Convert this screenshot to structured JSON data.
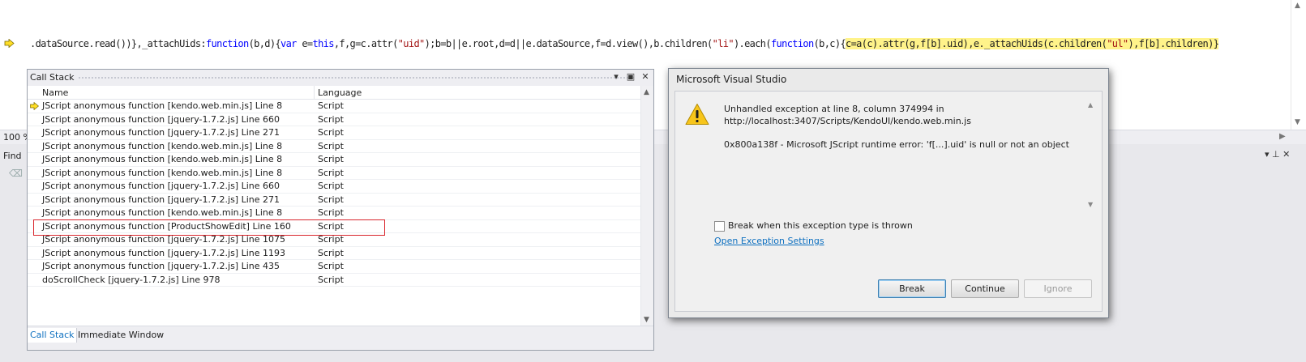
{
  "editor": {
    "code": {
      "prefix": ".dataSource.read())},_attachUids:",
      "kw_function1": "function",
      "args1": "(b,d){",
      "kw_var": "var",
      "mid1": " e=",
      "kw_this": "this",
      "mid2": ",f,g=c.attr(",
      "str_uid": "\"uid\"",
      "mid3": ");b=b||e.root,d=d||e.dataSource,f=d.view(),b.children(",
      "str_li": "\"li\"",
      "mid4": ").each(",
      "kw_function2": "function",
      "args2": "(b,c){",
      "hl_a": "c=a(c).attr(g,f[b].uid),e._attachUids(c.children(",
      "hl_str_ul": "\"ul\"",
      "hl_b": "),f[b].children)}"
    },
    "zoom": "100 %",
    "highlight_color": "#fff38a"
  },
  "find_panel": {
    "label": "Find"
  },
  "call_stack": {
    "title": "Call Stack",
    "columns": {
      "name": "Name",
      "language": "Language"
    },
    "rows": [
      {
        "name": "JScript anonymous function [kendo.web.min.js] Line 8",
        "language": "Script"
      },
      {
        "name": "JScript anonymous function [jquery-1.7.2.js] Line 660",
        "language": "Script"
      },
      {
        "name": "JScript anonymous function [jquery-1.7.2.js] Line 271",
        "language": "Script"
      },
      {
        "name": "JScript anonymous function [kendo.web.min.js] Line 8",
        "language": "Script"
      },
      {
        "name": "JScript anonymous function [kendo.web.min.js] Line 8",
        "language": "Script"
      },
      {
        "name": "JScript anonymous function [kendo.web.min.js] Line 8",
        "language": "Script"
      },
      {
        "name": "JScript anonymous function [jquery-1.7.2.js] Line 660",
        "language": "Script"
      },
      {
        "name": "JScript anonymous function [jquery-1.7.2.js] Line 271",
        "language": "Script"
      },
      {
        "name": "JScript anonymous function [kendo.web.min.js] Line 8",
        "language": "Script"
      },
      {
        "name": "JScript anonymous function [ProductShowEdit] Line 160",
        "language": "Script"
      },
      {
        "name": "JScript anonymous function [jquery-1.7.2.js] Line 1075",
        "language": "Script"
      },
      {
        "name": "JScript anonymous function [jquery-1.7.2.js] Line 1193",
        "language": "Script"
      },
      {
        "name": "JScript anonymous function [jquery-1.7.2.js] Line 435",
        "language": "Script"
      },
      {
        "name": "doScrollCheck [jquery-1.7.2.js] Line 978",
        "language": "Script"
      }
    ],
    "tabs": [
      "Call Stack",
      "Immediate Window"
    ]
  },
  "dialog": {
    "title": "Microsoft Visual Studio",
    "message_line1": "Unhandled exception at line 8, column 374994 in",
    "message_line2": "http://localhost:3407/Scripts/KendoUI/kendo.web.min.js",
    "message_line3": "0x800a138f - Microsoft JScript runtime error: 'f[...].uid' is null or not an object",
    "checkbox_label": "Break when this exception type is thrown",
    "link_label": "Open Exception Settings",
    "buttons": {
      "break": "Break",
      "continue": "Continue",
      "ignore": "Ignore"
    }
  }
}
